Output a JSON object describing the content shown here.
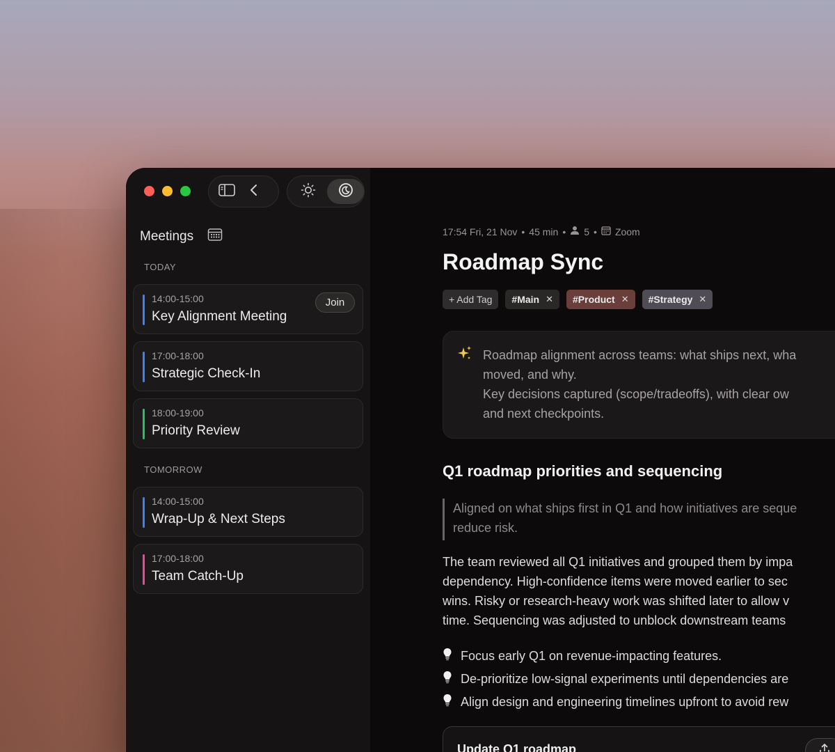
{
  "sidebar": {
    "title": "Meetings",
    "today_label": "TODAY",
    "tomorrow_label": "TOMORROW",
    "join_label": "Join",
    "today": [
      {
        "time": "14:00-15:00",
        "title": "Key Alignment Meeting",
        "color": "#3b82f6"
      },
      {
        "time": "17:00-18:00",
        "title": "Strategic Check-In",
        "color": "#3b82f6"
      },
      {
        "time": "18:00-19:00",
        "title": "Priority Review",
        "color": "#22c55e"
      }
    ],
    "tomorrow": [
      {
        "time": "14:00-15:00",
        "title": "Wrap-Up & Next Steps",
        "color": "#3b82f6"
      },
      {
        "time": "17:00-18:00",
        "title": "Team Catch-Up",
        "color": "#ec4899"
      }
    ]
  },
  "meta": {
    "datetime": "17:54 Fri, 21 Nov",
    "duration": "45 min",
    "attendees": "5",
    "platform": "Zoom"
  },
  "page": {
    "title": "Roadmap Sync",
    "tags": {
      "add": "+ Add Tag",
      "items": [
        "#Main",
        "#Product",
        "#Strategy"
      ]
    },
    "summary": {
      "line1": "Roadmap alignment across teams: what ships next, wha",
      "line2": "moved, and why.",
      "line3": "Key decisions captured (scope/tradeoffs), with clear ow",
      "line4": "and next checkpoints."
    },
    "section_heading": "Q1 roadmap priorities and sequencing",
    "quote": {
      "line1": "Aligned on what ships first in Q1 and how initiatives are seque",
      "line2": "reduce risk."
    },
    "paragraph": {
      "line1": "The team reviewed all Q1 initiatives and grouped them by impa",
      "line2": "dependency. High-confidence items were moved earlier to sec",
      "line3": "wins. Risky or research-heavy work was shifted later to allow v",
      "line4": "time. Sequencing was adjusted to unblock downstream teams"
    },
    "bullets": [
      "Focus early Q1 on revenue-impacting features.",
      "De-prioritize low-signal experiments until dependencies are",
      "Align design and engineering timelines upfront to avoid rew"
    ],
    "action_card": "Update Q1 roadmap"
  },
  "colors": {
    "accent_blue": "#3b82f6",
    "accent_green": "#22c55e",
    "accent_pink": "#ec4899",
    "tag_product": "#6a3e3a",
    "tag_strategy": "#4f4c55"
  },
  "icons": [
    "sidebar-toggle-icon",
    "chevron-left-icon",
    "sun-icon",
    "moon-icon",
    "calendar-icon",
    "person-icon",
    "sparkle-icon",
    "lightbulb-icon",
    "upload-icon"
  ]
}
